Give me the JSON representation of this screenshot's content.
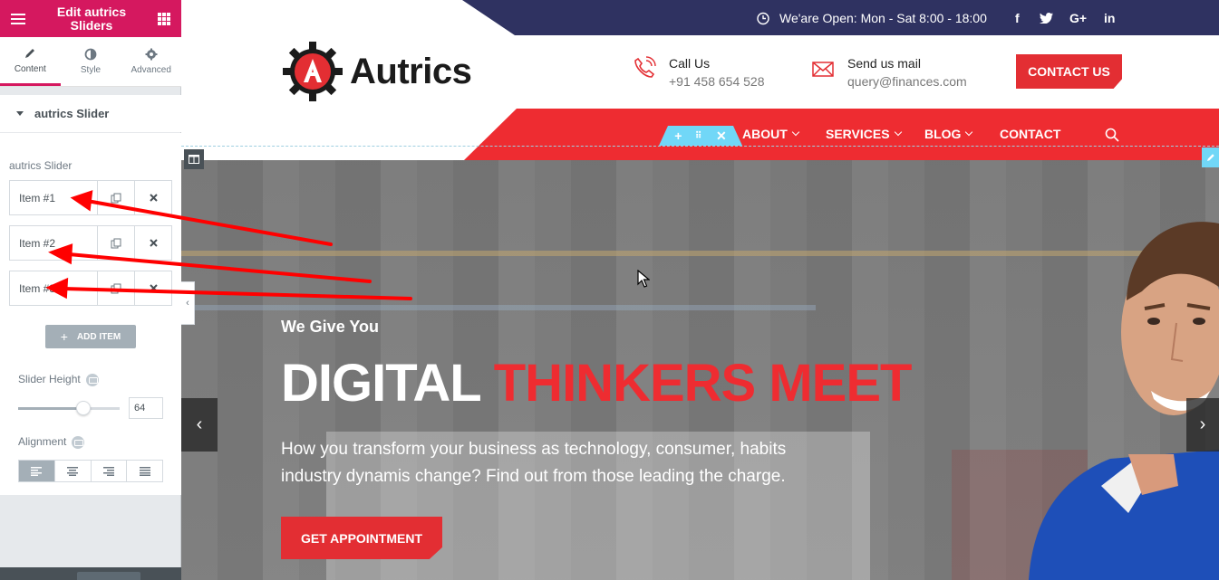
{
  "panel": {
    "title": "Edit autrics Sliders",
    "tabs": [
      {
        "label": "Content"
      },
      {
        "label": "Style"
      },
      {
        "label": "Advanced"
      }
    ],
    "section_title": "autrics Slider",
    "repeater_label": "autrics Slider",
    "items": [
      {
        "label": "Item #1"
      },
      {
        "label": "Item #2"
      },
      {
        "label": "Item #3"
      }
    ],
    "add_item_label": "ADD ITEM",
    "slider_height_label": "Slider Height",
    "slider_height_value": "64",
    "slider_height_fraction": 0.64,
    "alignment_label": "Alignment"
  },
  "site": {
    "open_hours": "We'are Open: Mon - Sat 8:00 - 18:00",
    "social": [
      "f",
      "t",
      "G+",
      "in"
    ],
    "logo_text": "Autrics",
    "call_title": "Call Us",
    "call_number": "+91 458 654 528",
    "mail_title": "Send us mail",
    "mail_address": "query@finances.com",
    "contact_button": "CONTACT US",
    "nav": [
      {
        "label": "ABOUT"
      },
      {
        "label": "SERVICES"
      },
      {
        "label": "BLOG"
      },
      {
        "label": "CONTACT"
      }
    ],
    "hero_pretitle": "We Give You",
    "hero_title_white": "DIGITAL",
    "hero_title_red": "THINKERS MEET",
    "hero_desc": "How you transform your business as technology, consumer, habits industry dynamis change? Find out from those leading the charge.",
    "hero_button": "GET APPOINTMENT",
    "arrow_prev": "‹",
    "arrow_next": "›"
  },
  "colors": {
    "editor_accent": "#d5185f",
    "brand_red": "#ee2c31",
    "topbar_navy": "#2f3261",
    "editor_handle": "#71d7f7",
    "annotation_red": "#ff0000"
  }
}
